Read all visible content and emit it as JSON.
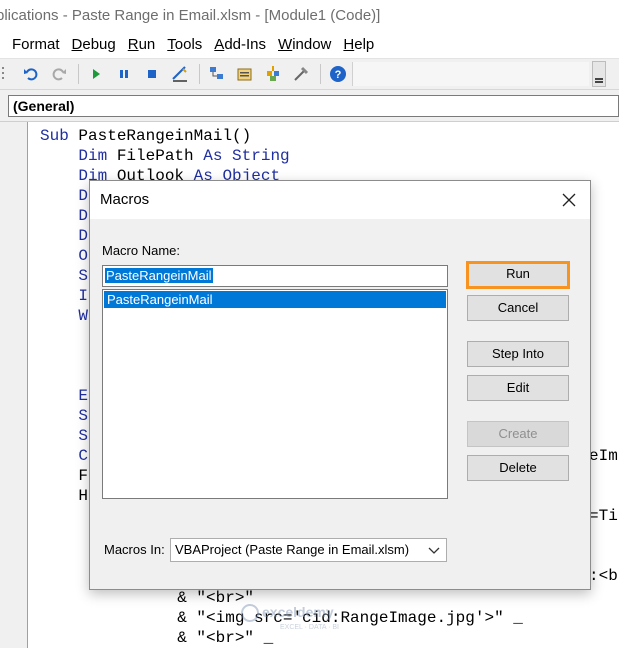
{
  "window": {
    "title": "plications - Paste Range in Email.xlsm - [Module1 (Code)]"
  },
  "menu": [
    {
      "pre": "",
      "acc": "",
      "post": "Format"
    },
    {
      "pre": "",
      "acc": "D",
      "post": "ebug"
    },
    {
      "pre": "",
      "acc": "R",
      "post": "un"
    },
    {
      "pre": "",
      "acc": "T",
      "post": "ools"
    },
    {
      "pre": "",
      "acc": "A",
      "post": "dd-Ins"
    },
    {
      "pre": "",
      "acc": "W",
      "post": "indow"
    },
    {
      "pre": "",
      "acc": "H",
      "post": "elp"
    }
  ],
  "toolbar": {
    "icons": [
      "undo-icon",
      "redo-icon",
      "run-icon",
      "break-icon",
      "reset-icon",
      "design-mode-icon",
      "project-explorer-icon",
      "properties-icon",
      "object-browser-icon",
      "toolbox-icon",
      "help-icon"
    ],
    "accent_blue": "#1e63c8",
    "run_green": "#1e9a3a"
  },
  "object_combo": {
    "value": "(General)"
  },
  "code": {
    "lines": [
      {
        "kw": "Sub",
        "text": " PasteRangeinMail()"
      },
      {
        "kw": "    Dim",
        "text": " FilePath ",
        "kw2": "As String"
      },
      {
        "kw": "    Dim",
        "text": " Outlook ",
        "kw2": "As Object"
      },
      {
        "kw": "    D",
        "text": ""
      },
      {
        "kw": "    D",
        "text": ""
      },
      {
        "kw": "    D",
        "text": ""
      },
      {
        "kw": "    O",
        "text": ""
      },
      {
        "kw": "    S",
        "text": ""
      },
      {
        "kw": "    I",
        "text": ""
      },
      {
        "kw": "    W",
        "text": ""
      },
      {
        "kw": "",
        "text": ""
      },
      {
        "kw": "",
        "text": ""
      },
      {
        "kw": "",
        "text": ""
      },
      {
        "kw": "    E",
        "text": ""
      },
      {
        "kw": "    S",
        "text": ""
      },
      {
        "kw": "    S",
        "text": ""
      },
      {
        "kw": "    C",
        "text": ""
      },
      {
        "kw": "    F",
        "text": ""
      },
      {
        "kw": "    H",
        "text": ""
      }
    ],
    "right_fragments": [
      "eIm",
      "=Ti",
      ":<b"
    ],
    "tail_lines": [
      "            & \"<br>\"",
      "            & \"<img src='cid:RangeImage.jpg'>\" _",
      "            & \"<br>\" _"
    ]
  },
  "dialog": {
    "title": "Macros",
    "macro_name_label": "Macro Name:",
    "macro_name_value": "PasteRangeinMail",
    "macro_list": [
      "PasteRangeinMail"
    ],
    "buttons": {
      "run": "Run",
      "cancel": "Cancel",
      "step_into": "Step Into",
      "edit": "Edit",
      "create": "Create",
      "delete": "Delete"
    },
    "macros_in_label": "Macros In:",
    "macros_in_value": "VBAProject (Paste Range in Email.xlsm)",
    "run_highlight_color": "#f7931e"
  },
  "watermark": {
    "brand": "exceldemy",
    "tagline": "EXCEL · DATA · BI"
  }
}
